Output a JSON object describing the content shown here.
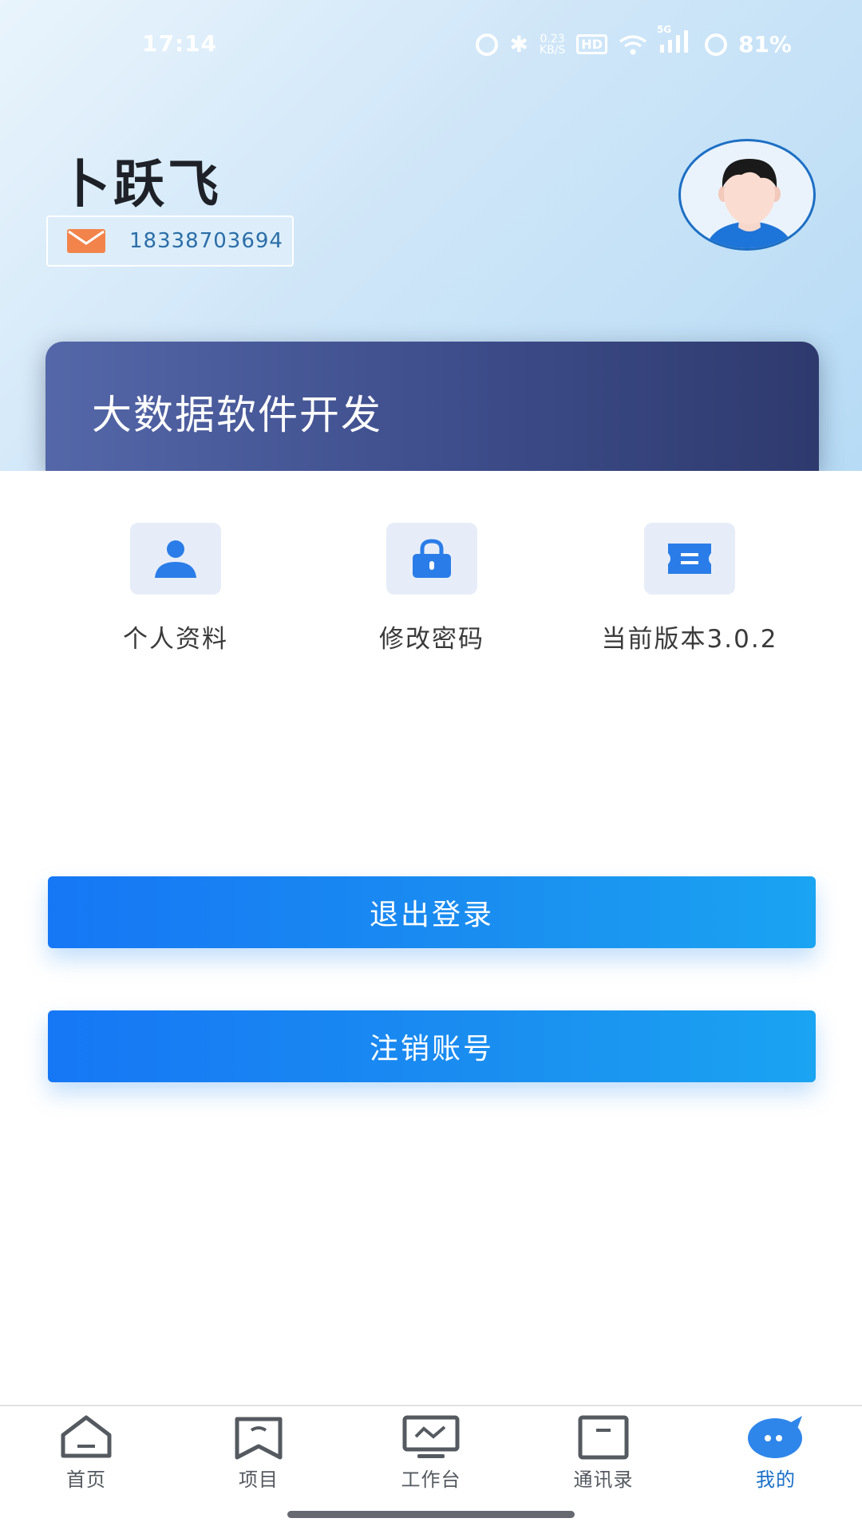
{
  "status_bar": {
    "time": "17:14",
    "speed_top": "0.23",
    "speed_bottom": "KB/S",
    "hd": "HD",
    "network": "5G",
    "battery": "81%",
    "icons": [
      "alarm-icon",
      "bluetooth-icon",
      "wifi-icon",
      "signal-icon",
      "battery-icon"
    ]
  },
  "profile": {
    "name": "卜跃飞",
    "phone": "18338703694",
    "organization": "大数据软件开发"
  },
  "quick_actions": [
    {
      "label": "个人资料",
      "icon": "person-icon"
    },
    {
      "label": "修改密码",
      "icon": "lock-icon"
    },
    {
      "label": "当前版本3.0.2",
      "icon": "ticket-icon"
    }
  ],
  "buttons": {
    "logout": "退出登录",
    "deactivate": "注销账号"
  },
  "tabs": [
    {
      "label": "首页",
      "icon": "home-icon",
      "active": false
    },
    {
      "label": "项目",
      "icon": "project-icon",
      "active": false
    },
    {
      "label": "工作台",
      "icon": "workbench-icon",
      "active": false
    },
    {
      "label": "通讯录",
      "icon": "contacts-icon",
      "active": false
    },
    {
      "label": "我的",
      "icon": "chat-bubble-icon",
      "active": true
    }
  ],
  "colors": {
    "primary": "#1a7ff2",
    "tab_active": "#1a6fc8",
    "card_start": "#5467a8",
    "card_end": "#2e3a6e",
    "mail_orange": "#f2844b"
  }
}
